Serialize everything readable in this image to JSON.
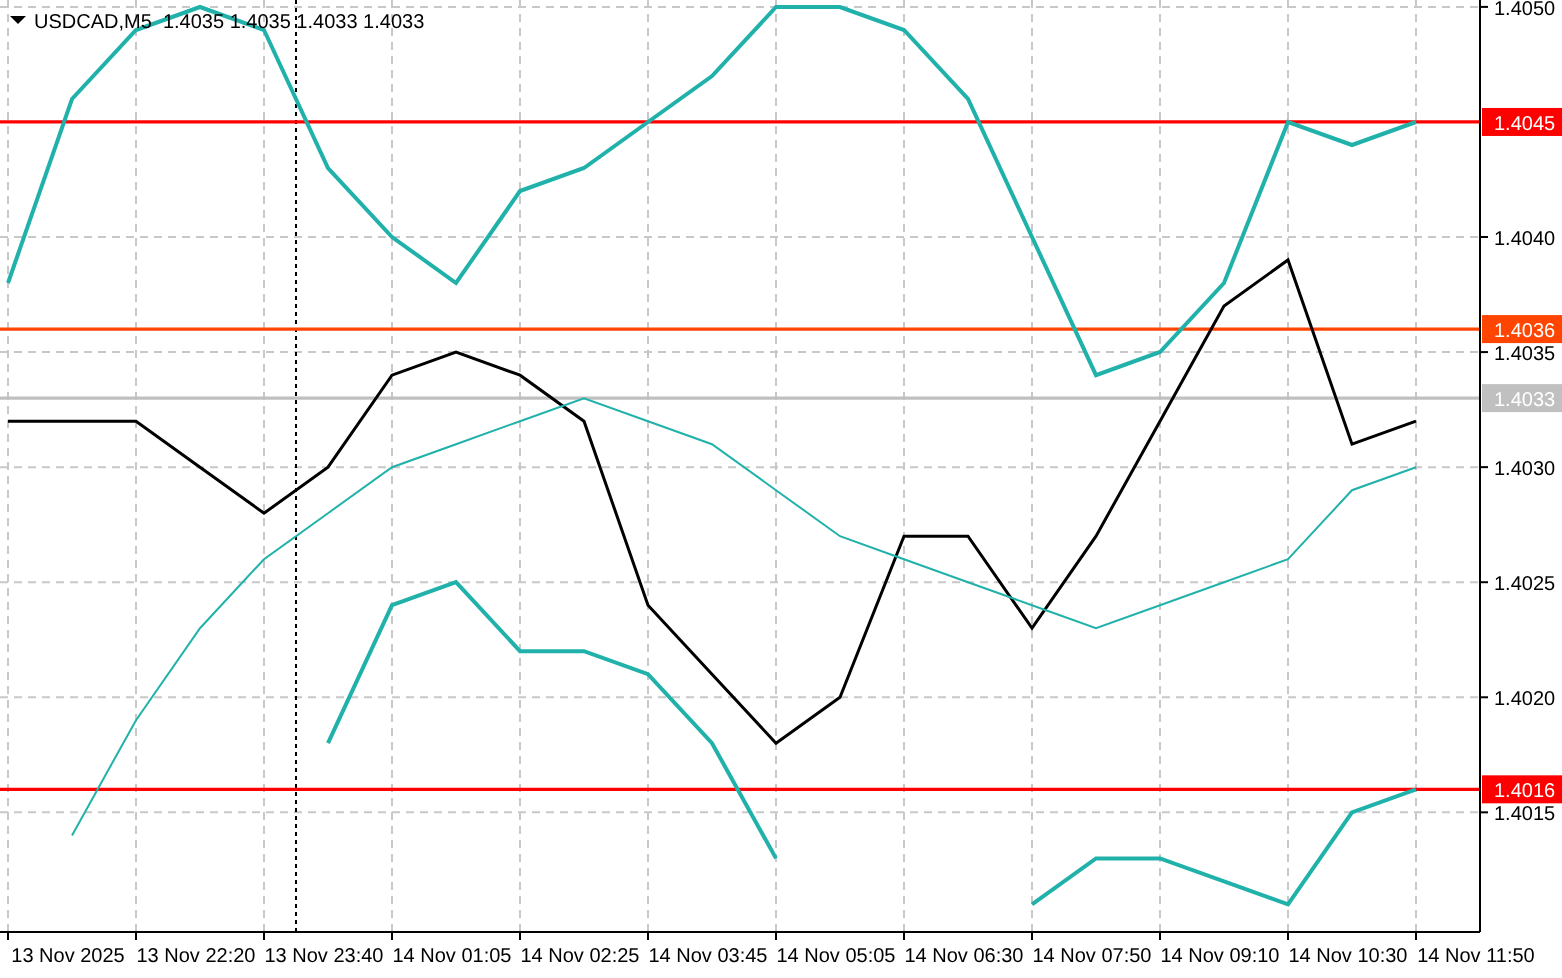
{
  "chart_data": {
    "type": "line",
    "title": "USDCAD,M5  1.4035 1.4035 1.4033 1.4033",
    "categories": [
      null,
      "13 Nov 2025",
      null,
      "13 Nov 22:20",
      null,
      "13 Nov 23:40",
      null,
      "14 Nov 01:05",
      null,
      "14 Nov 02:25",
      null,
      "14 Nov 03:45",
      null,
      "14 Nov 05:05",
      null,
      "14 Nov 06:30",
      null,
      "14 Nov 07:50",
      null,
      "14 Nov 09:10",
      null,
      "14 Nov 10:30",
      null,
      "14 Nov 11:50"
    ],
    "series": [
      {
        "color": "#000000",
        "values": [
          1.4032,
          1.4032,
          1.4032,
          1.403,
          1.4028,
          1.403,
          1.4034,
          1.4035,
          1.4034,
          1.4032,
          1.4024,
          1.4021,
          1.4018,
          1.402,
          1.4027,
          1.4027,
          1.4023,
          1.4027,
          1.4032,
          1.4037,
          1.4039,
          1.4031,
          1.4032,
          null
        ]
      },
      {
        "color": "#20b2aa",
        "values": [
          1.4038,
          1.4046,
          1.4049,
          1.405,
          1.4049,
          1.4043,
          1.404,
          1.4038,
          1.4042,
          1.4043,
          1.4045,
          1.4047,
          1.405,
          1.405,
          1.4049,
          1.4046,
          1.404,
          1.4034,
          1.4035,
          1.4038,
          1.4045,
          1.4044,
          1.4045,
          null
        ]
      },
      {
        "color": "#20b2aa",
        "values": [
          null,
          1.4014,
          1.4019,
          1.4023,
          1.4026,
          1.4028,
          1.403,
          1.4031,
          1.4032,
          1.4033,
          1.4032,
          1.4031,
          1.4029,
          1.4027,
          1.4026,
          1.4025,
          1.4024,
          1.4023,
          1.4024,
          1.4025,
          1.4026,
          1.4029,
          1.403,
          null
        ]
      },
      {
        "color": "#20b2aa",
        "values": [
          null,
          null,
          null,
          null,
          null,
          1.4018,
          1.4024,
          1.4025,
          1.4022,
          1.4022,
          1.4021,
          1.4018,
          1.4013,
          null,
          null,
          null,
          1.4011,
          1.4013,
          1.4013,
          1.4012,
          1.4011,
          1.4015,
          1.4016,
          null
        ]
      }
    ],
    "ylim": [
      1.40098,
      1.40503
    ],
    "grid": true,
    "yticks": [
      {
        "value": 1.4015,
        "label": "1.4015"
      },
      {
        "value": 1.402,
        "label": "1.4020"
      },
      {
        "value": 1.4025,
        "label": "1.4025"
      },
      {
        "value": 1.403,
        "label": "1.4030"
      },
      {
        "value": 1.4035,
        "label": "1.4035"
      },
      {
        "value": 1.404,
        "label": "1.4040"
      },
      {
        "value": 1.405,
        "label": "1.4050"
      }
    ],
    "ref_lines": [
      {
        "axis": "y",
        "value": 1.4045,
        "label": "1.4045",
        "color": "#ff0000"
      },
      {
        "axis": "y",
        "value": 1.4036,
        "label": "1.4036",
        "color": "#ff4500"
      },
      {
        "axis": "y",
        "value": 1.4016,
        "label": "1.4016",
        "color": "#ff0000"
      },
      {
        "axis": "y",
        "value": 1.4033,
        "label": "1.4033",
        "color": "#c0c0c0"
      }
    ]
  }
}
